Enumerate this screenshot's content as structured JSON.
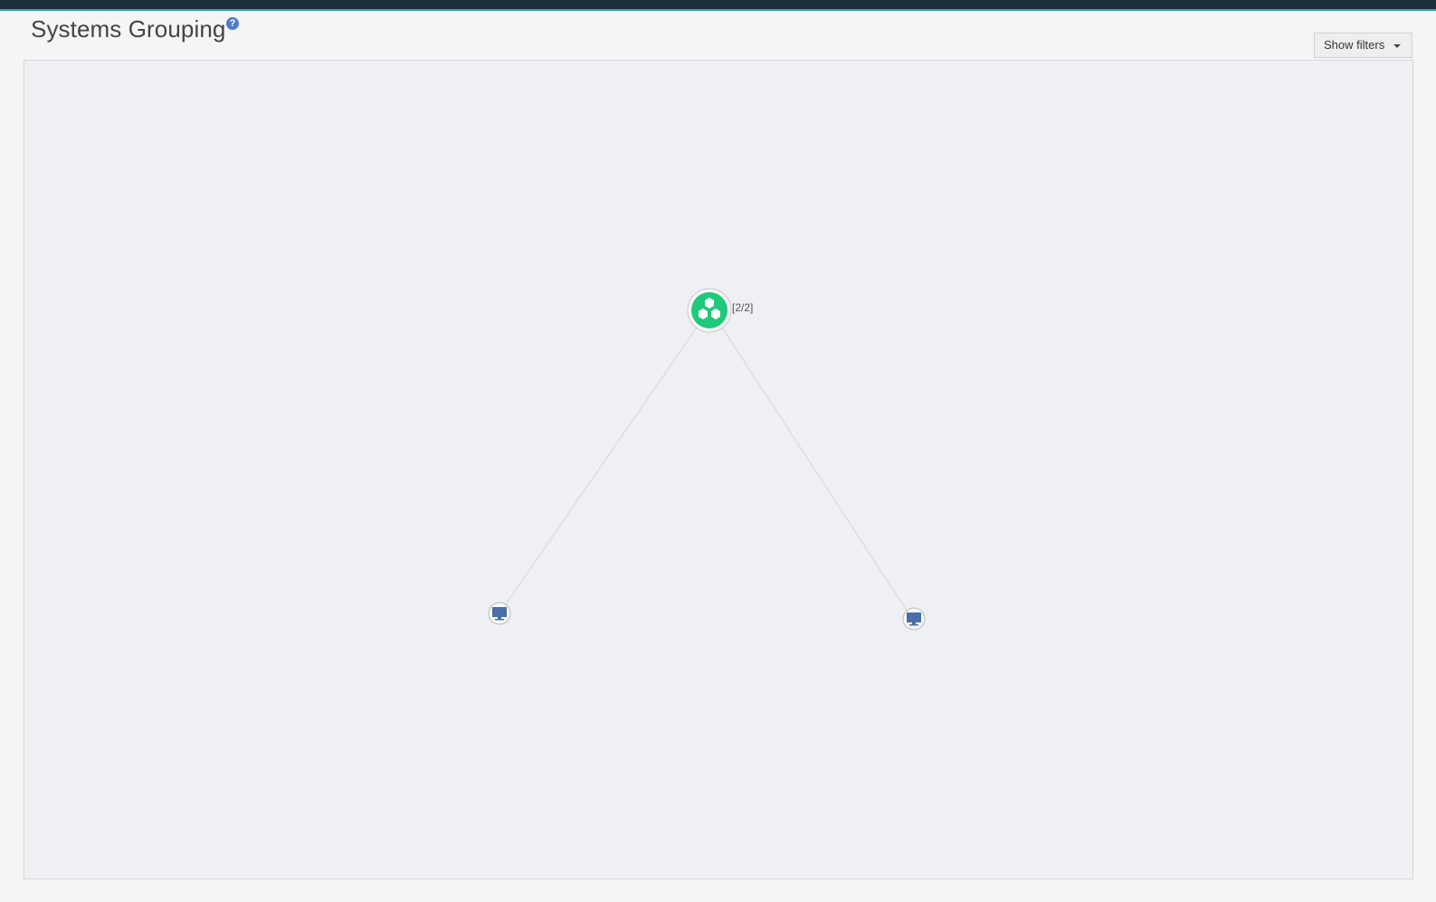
{
  "header": {
    "title": "Systems Grouping",
    "help_icon": "question-circle-icon"
  },
  "toolbar": {
    "filters_label": "Show filters",
    "filters_icon": "caret-down-icon"
  },
  "graph": {
    "group_node": {
      "icon": "cluster-group-icon",
      "label": "[2/2]",
      "color": "#1ec97a"
    },
    "system_nodes": [
      {
        "icon": "monitor-icon",
        "color": "#4a6fa8"
      },
      {
        "icon": "monitor-icon",
        "color": "#4a6fa8"
      }
    ]
  },
  "colors": {
    "topbar": "#1a2f3a",
    "topbar_accent": "#2ea79b",
    "canvas_bg": "#eff0f3",
    "edge": "#d6d6d6"
  }
}
